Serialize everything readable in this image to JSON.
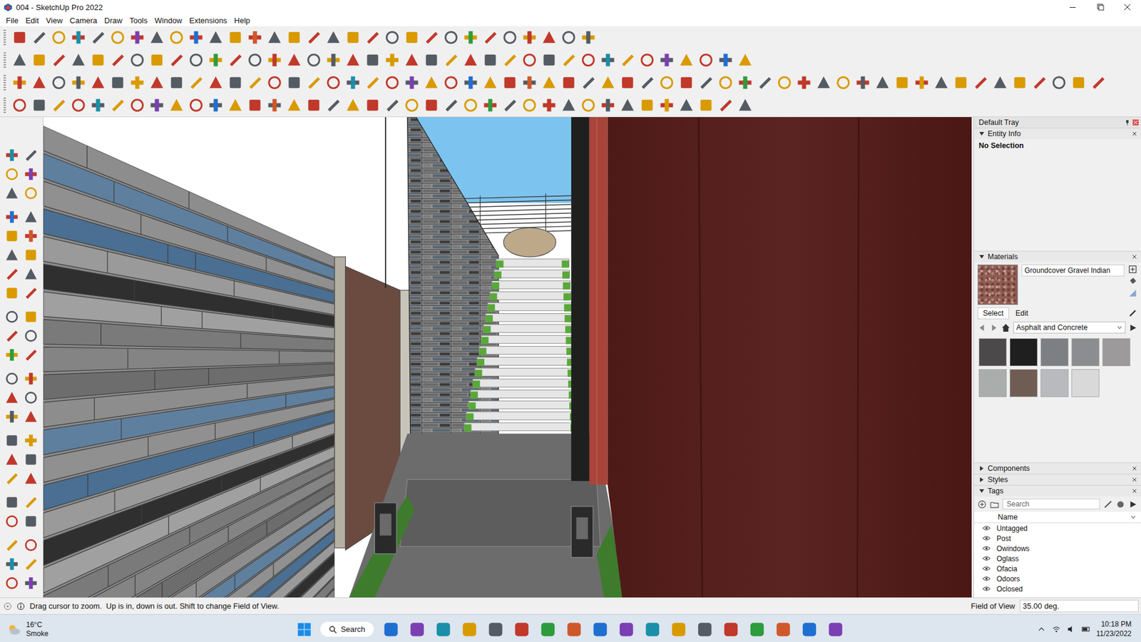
{
  "window": {
    "title": "004 - SketchUp Pro 2022"
  },
  "menu": [
    "File",
    "Edit",
    "View",
    "Camera",
    "Draw",
    "Tools",
    "Window",
    "Extensions",
    "Help"
  ],
  "tray": {
    "title": "Default Tray",
    "entity_info": {
      "title": "Entity Info",
      "expanded": true,
      "value": "No Selection"
    },
    "materials": {
      "title": "Materials",
      "expanded": true,
      "current": "Groundcover Gravel Indian",
      "tabs": [
        {
          "label": "Select",
          "selected": true
        },
        {
          "label": "Edit",
          "selected": false
        }
      ],
      "collection": "Asphalt and Concrete",
      "swatches": [
        {
          "color": "#4c494a"
        },
        {
          "color": "#1f1f20"
        },
        {
          "color": "#7c8085"
        },
        {
          "color": "#8b8d90"
        },
        {
          "color": "#9c9a9a"
        },
        {
          "color": "#a9adab"
        },
        {
          "color": "#6f5d54"
        },
        {
          "color": "#b9babd"
        },
        {
          "color": "#d9d9da"
        }
      ]
    },
    "components": {
      "title": "Components",
      "expanded": false
    },
    "styles": {
      "title": "Styles",
      "expanded": false
    },
    "tags": {
      "title": "Tags",
      "expanded": true,
      "search_placeholder": "Search",
      "column": "Name",
      "items": [
        {
          "name": "Untagged",
          "visible": true
        },
        {
          "name": "Post",
          "visible": true
        },
        {
          "name": "Owindows",
          "visible": true
        },
        {
          "name": "Oglass",
          "visible": true
        },
        {
          "name": "Ofacia",
          "visible": true
        },
        {
          "name": "Odoors",
          "visible": true
        },
        {
          "name": "Oclosed",
          "visible": true
        }
      ]
    }
  },
  "status_bar": {
    "message": "Drag cursor to zoom.  Up is in, down is out. Shift to change Field of View.",
    "measure_label": "Field of View",
    "measure_value": "35.00 deg."
  },
  "taskbar": {
    "weather_temp": "16°C",
    "weather_desc": "Smoke",
    "search": "Search",
    "time": "10:18 PM",
    "date": "11/23/2022"
  }
}
